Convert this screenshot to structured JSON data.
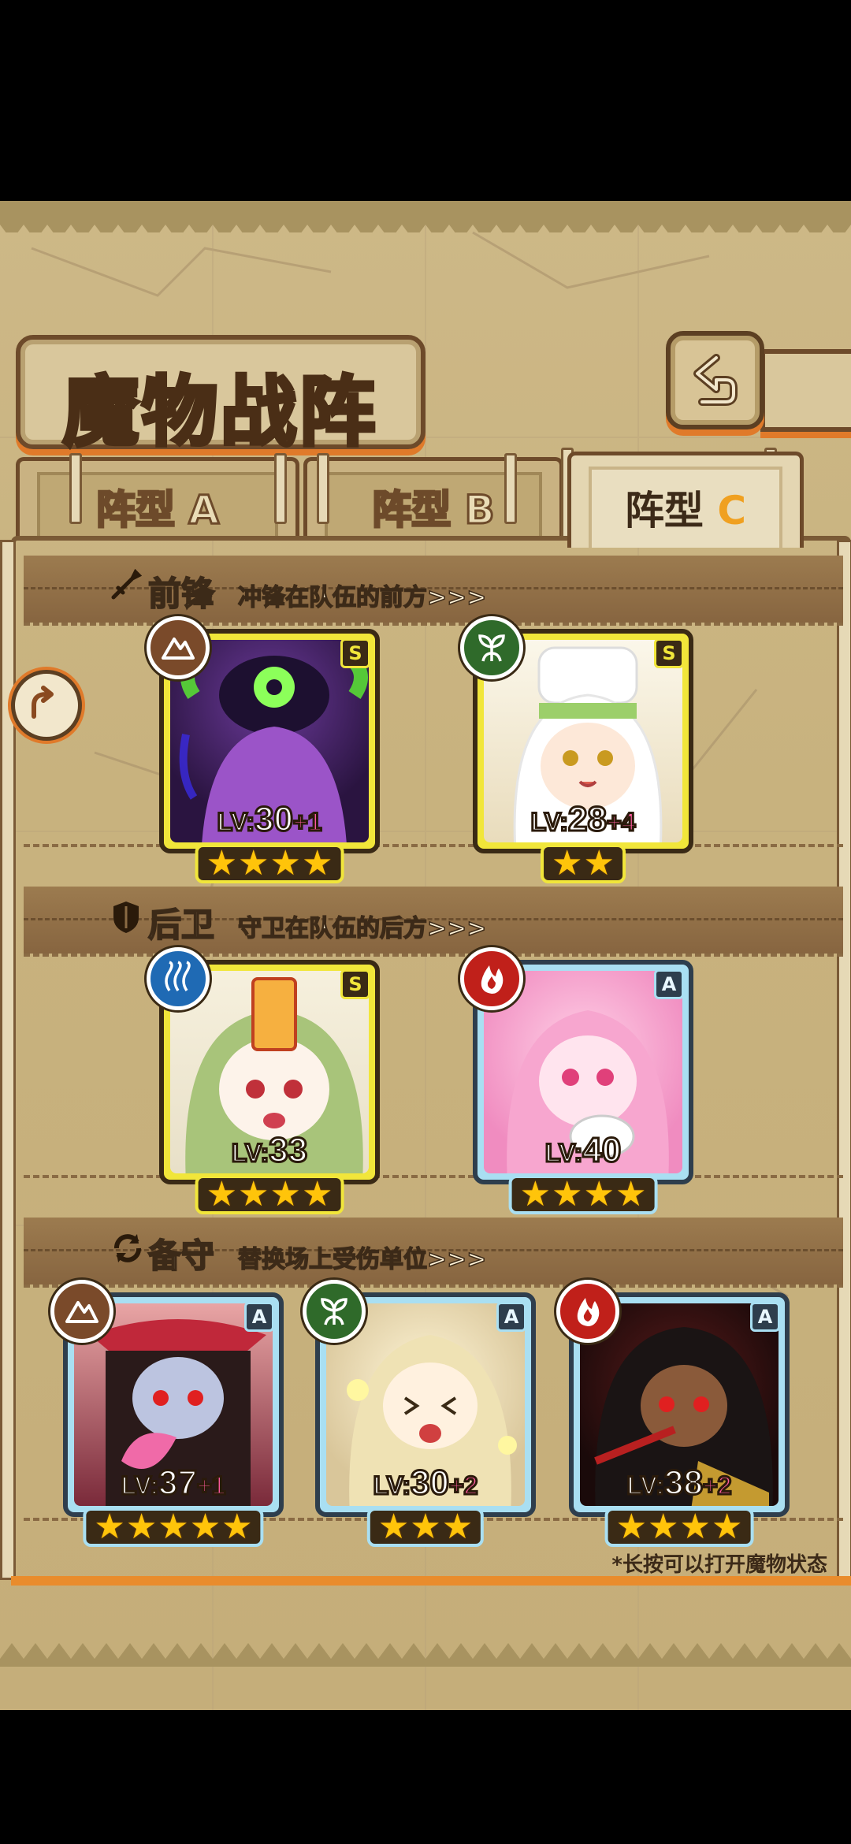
{
  "title": "魔物战阵",
  "tabs": [
    {
      "label": "阵型",
      "letter": "A",
      "active": false
    },
    {
      "label": "阵型",
      "letter": "B",
      "active": false
    },
    {
      "label": "阵型",
      "letter": "C",
      "active": true
    }
  ],
  "sections": {
    "front": {
      "title": "前锋",
      "subtitle": "冲锋在队伍的前方>>>",
      "icon": "sword-icon"
    },
    "rear": {
      "title": "后卫",
      "subtitle": "守卫在队伍的后方>>>",
      "icon": "shield-icon"
    },
    "reserve": {
      "title": "备守",
      "subtitle": "替换场上受伤单位>>>",
      "icon": "swap-icon"
    }
  },
  "lv_prefix": "LV:",
  "monsters": [
    {
      "rank": "S",
      "element": "earth",
      "element_color": "#7a4a2a",
      "level": "30",
      "bonus": "+1",
      "stars": 4
    },
    {
      "rank": "S",
      "element": "wind",
      "element_color": "#2f6a2a",
      "level": "28",
      "bonus": "+4",
      "stars": 2
    },
    {
      "rank": "S",
      "element": "water",
      "element_color": "#1f6ab4",
      "level": "33",
      "bonus": "",
      "stars": 4
    },
    {
      "rank": "A",
      "element": "fire",
      "element_color": "#c0201a",
      "level": "40",
      "bonus": "",
      "stars": 4
    },
    {
      "rank": "A",
      "element": "earth",
      "element_color": "#7a4a2a",
      "level": "37",
      "bonus": "+1",
      "stars": 5
    },
    {
      "rank": "A",
      "element": "wind",
      "element_color": "#2f6a2a",
      "level": "30",
      "bonus": "+2",
      "stars": 3
    },
    {
      "rank": "A",
      "element": "fire",
      "element_color": "#c0201a",
      "level": "38",
      "bonus": "+2",
      "stars": 4
    }
  ],
  "hint": "*长按可以打开魔物状态",
  "colors": {
    "accent": "#e07a2a",
    "s_frame": "#f1e63a",
    "a_frame": "#a9dff2"
  }
}
